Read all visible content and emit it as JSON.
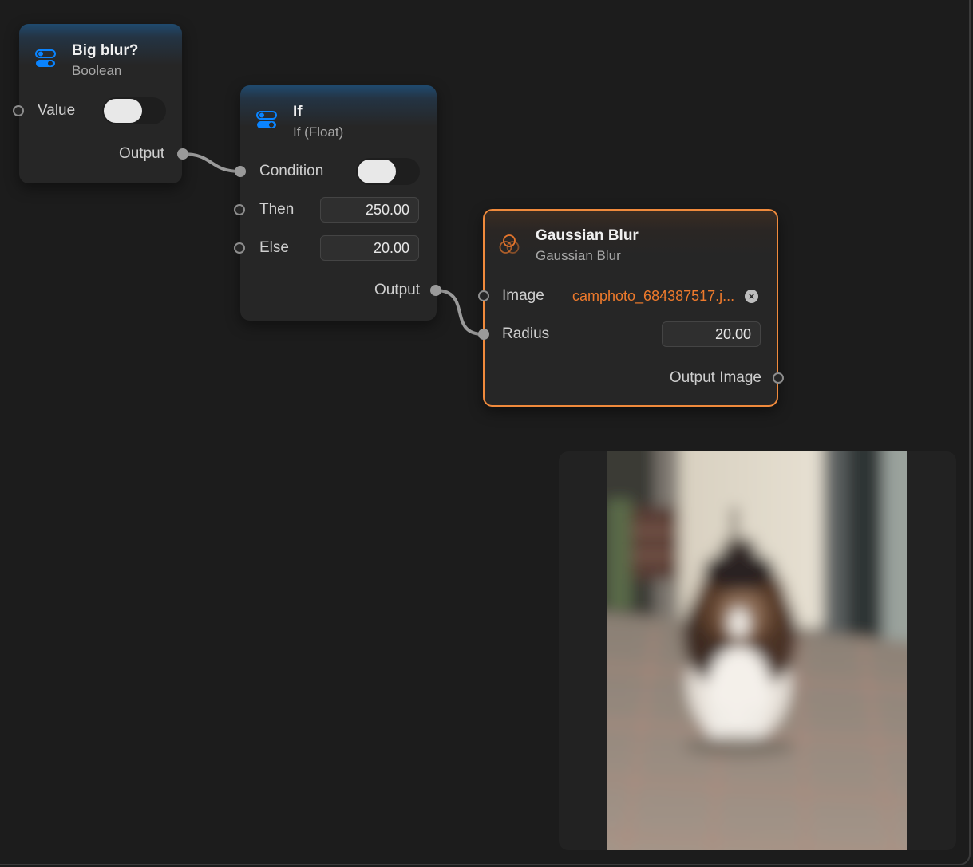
{
  "nodes": {
    "boolean": {
      "title": "Big blur?",
      "subtitle": "Boolean",
      "value_label": "Value",
      "value_on": false,
      "output_label": "Output"
    },
    "if_node": {
      "title": "If",
      "subtitle": "If (Float)",
      "condition_label": "Condition",
      "condition_on": false,
      "then_label": "Then",
      "then_value": "250.00",
      "else_label": "Else",
      "else_value": "20.00",
      "output_label": "Output"
    },
    "gaussian": {
      "title": "Gaussian Blur",
      "subtitle": "Gaussian Blur",
      "image_label": "Image",
      "image_file": "camphoto_684387517.j...",
      "radius_label": "Radius",
      "radius_value": "20.00",
      "output_label": "Output Image"
    }
  },
  "colors": {
    "accent": "#0a84ff",
    "selection": "#f08a3c",
    "file_link": "#ee7a2c"
  },
  "icons": {
    "boolean": "toggle-switches-icon",
    "if_node": "toggle-switches-icon",
    "gaussian": "blur-circles-icon"
  }
}
